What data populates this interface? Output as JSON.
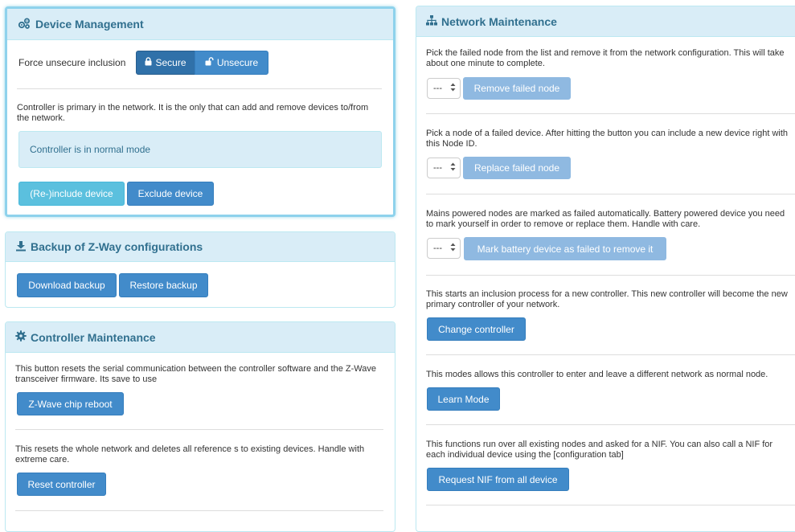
{
  "device_management": {
    "title": "Device Management",
    "force_label": "Force unsecure inclusion",
    "secure_label": "Secure",
    "unsecure_label": "Unsecure",
    "primary_text": "Controller is primary in the network. It is the only that can add and remove devices to/from the network.",
    "mode_text": "Controller is in normal mode",
    "include_label": "(Re-)include device",
    "exclude_label": "Exclude device"
  },
  "backup": {
    "title": "Backup of Z-Way configurations",
    "download_label": "Download backup",
    "restore_label": "Restore backup"
  },
  "controller_maintenance": {
    "title": "Controller Maintenance",
    "reset_serial_text": "This button resets the serial communication between the controller software and the Z-Wave transceiver firmware. Its save to use",
    "reboot_label": "Z-Wave chip reboot",
    "reset_network_text": "This resets the whole network and deletes all reference s to existing devices. Handle with extreme care.",
    "reset_label": "Reset controller"
  },
  "network_maintenance": {
    "title": "Network Maintenance",
    "remove_text": "Pick the failed node from the list and remove it from the network configuration. This will take about one minute to complete.",
    "remove_select": "---",
    "remove_label": "Remove failed node",
    "replace_text": "Pick a node of a failed device. After hitting the button you can include a new device right with this Node ID.",
    "replace_select": "---",
    "replace_label": "Replace failed node",
    "battery_text": "Mains powered nodes are marked as failed automatically. Battery powered device you need to mark yourself in order to remove or replace them. Handle with care.",
    "battery_select": "---",
    "battery_label": "Mark battery device as failed to remove it",
    "change_text": "This starts an inclusion process for a new controller. This new controller will become the new primary controller of your network.",
    "change_label": "Change controller",
    "learn_text": "This modes allows this controller to enter and leave a different network as normal node.",
    "learn_label": "Learn Mode",
    "nif_text": "This functions run over all existing nodes and asked for a NIF. You can also call a NIF for each individual device using the [configuration tab]",
    "nif_label": "Request NIF from all device"
  }
}
